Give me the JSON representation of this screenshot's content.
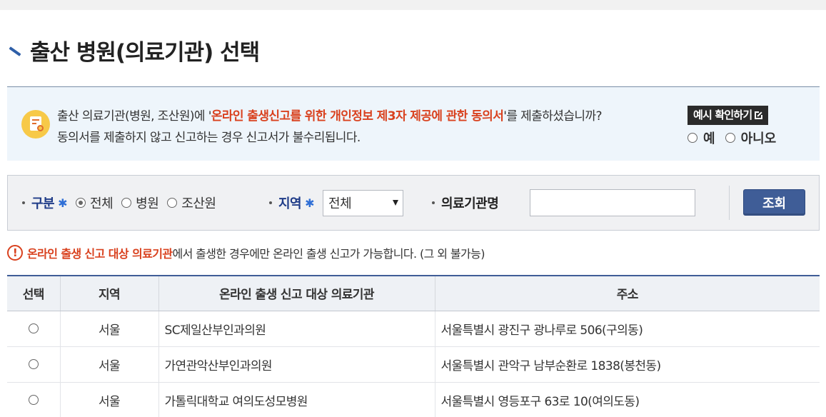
{
  "page": {
    "title": "출산 병원(의료기관) 선택"
  },
  "consent": {
    "text_before": "출산 의료기관(병원, 조산원)에 '",
    "highlight": "온라인 출생신고를 위한 개인정보 제3자 제공에 관한 동의서",
    "text_after": "'를 제출하셨습니까?",
    "line2": "동의서를 제출하지 않고 신고하는 경우 신고서가 불수리됩니다.",
    "example_button": "예시 확인하기",
    "yes_label": "예",
    "no_label": "아니오"
  },
  "search": {
    "type_label": "구분",
    "type_options": [
      "전체",
      "병원",
      "조산원"
    ],
    "type_selected": "전체",
    "region_label": "지역",
    "region_value": "전체",
    "name_label": "의료기관명",
    "name_value": "",
    "search_button": "조회"
  },
  "notice": {
    "highlight": "온라인 출생 신고 대상 의료기관",
    "text": "에서 출생한 경우에만 온라인 출생 신고가 가능합니다. (그 외 불가능)"
  },
  "table": {
    "headers": [
      "선택",
      "지역",
      "온라인 출생 신고 대상 의료기관",
      "주소"
    ],
    "rows": [
      {
        "region": "서울",
        "name": "SC제일산부인과의원",
        "address": "서울특별시 광진구 광나루로 506(구의동)"
      },
      {
        "region": "서울",
        "name": "가연관악산부인과의원",
        "address": "서울특별시 관악구 남부순환로 1838(봉천동)"
      },
      {
        "region": "서울",
        "name": "가톨릭대학교 여의도성모병원",
        "address": "서울특별시 영등포구 63로 10(여의도동)"
      }
    ]
  },
  "colors": {
    "accent_blue": "#3f5d97",
    "highlight_red": "#d9411e",
    "consent_bg": "#eef5fb"
  }
}
